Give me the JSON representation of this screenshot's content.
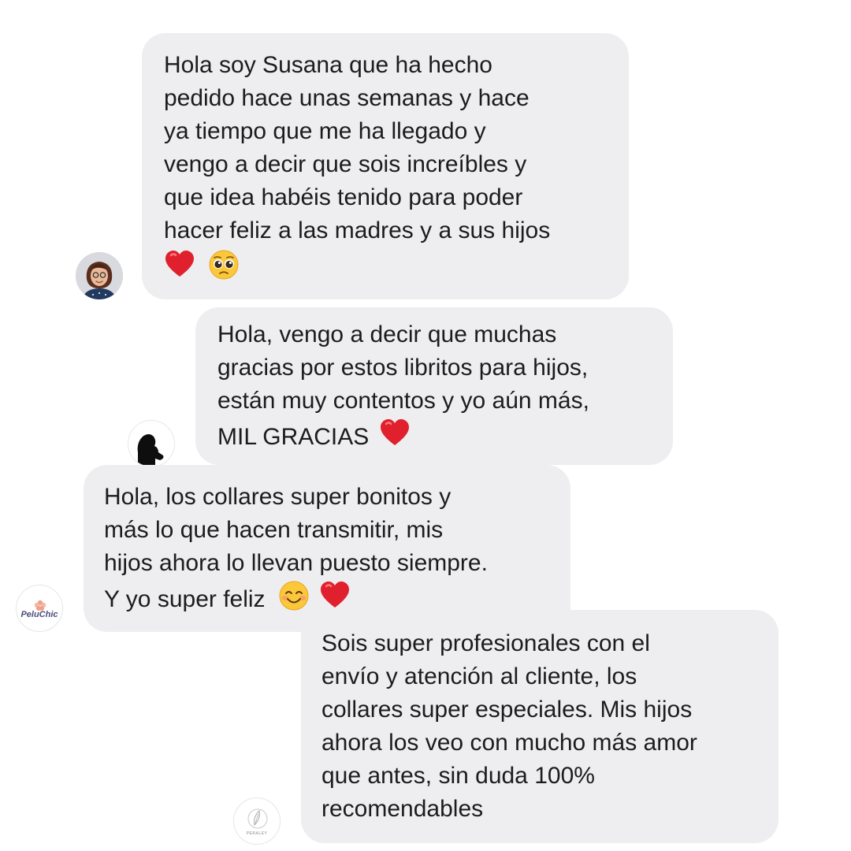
{
  "messages": [
    {
      "lines": [
        "Hola soy Susana que ha hecho",
        "pedido hace unas semanas y hace",
        "ya tiempo que me ha llegado y",
        "vengo a decir que sois increíbles y",
        "que idea habéis tenido para poder",
        "hacer feliz a las madres y a sus hijos"
      ],
      "emojis": [
        "red-heart",
        "pleading-face"
      ]
    },
    {
      "lines": [
        "Hola, vengo a decir que muchas",
        "gracias por estos libritos para hijos,",
        "están muy contentos y yo aún más,",
        "MIL GRACIAS"
      ],
      "emojis": [
        "red-heart"
      ]
    },
    {
      "lines": [
        "Hola, los collares super bonitos y",
        "más lo que hacen transmitir, mis",
        "hijos ahora lo llevan puesto siempre.",
        "Y yo super feliz"
      ],
      "emojis": [
        "smiling-face",
        "red-heart"
      ]
    },
    {
      "lines": [
        "Sois super profesionales con el",
        "envío y atención al cliente, los",
        "collares super especiales. Mis hijos",
        "ahora los veo con mucho más amor",
        "que antes, sin duda 100%",
        "recomendables"
      ],
      "emojis": []
    }
  ],
  "avatars": {
    "brand_1": "PeluChic",
    "brand_2": "PERALEY"
  },
  "colors": {
    "bubble": "#eeeef0",
    "text": "#1c1c1e",
    "heart": "#e0212d"
  }
}
